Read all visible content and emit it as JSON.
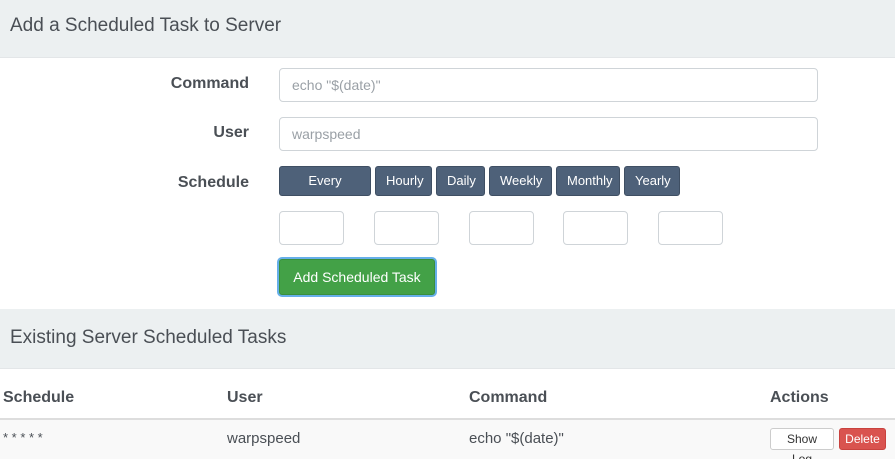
{
  "add_panel": {
    "title": "Add a Scheduled Task to Server",
    "command_label": "Command",
    "command_placeholder": "echo \"$(date)\"",
    "user_label": "User",
    "user_placeholder": "warpspeed",
    "schedule_label": "Schedule",
    "schedule_buttons": [
      "Every Minute",
      "Hourly",
      "Daily",
      "Weekly",
      "Monthly",
      "Yearly"
    ],
    "cron_fields": [
      "",
      "",
      "",
      "",
      ""
    ],
    "submit_label": "Add Scheduled Task"
  },
  "existing_panel": {
    "title": "Existing Server Scheduled Tasks",
    "columns": [
      "Schedule",
      "User",
      "Command",
      "Actions"
    ],
    "rows": [
      {
        "schedule": "* * * * *",
        "user": "warpspeed",
        "command": "echo \"$(date)\"",
        "show_log_label": "Show Log",
        "delete_label": "Delete"
      }
    ]
  },
  "colors": {
    "heading_bg": "#ecf0f1",
    "schedule_button": "#4e6179",
    "submit_button": "#43a147",
    "delete_button": "#d9534f"
  }
}
